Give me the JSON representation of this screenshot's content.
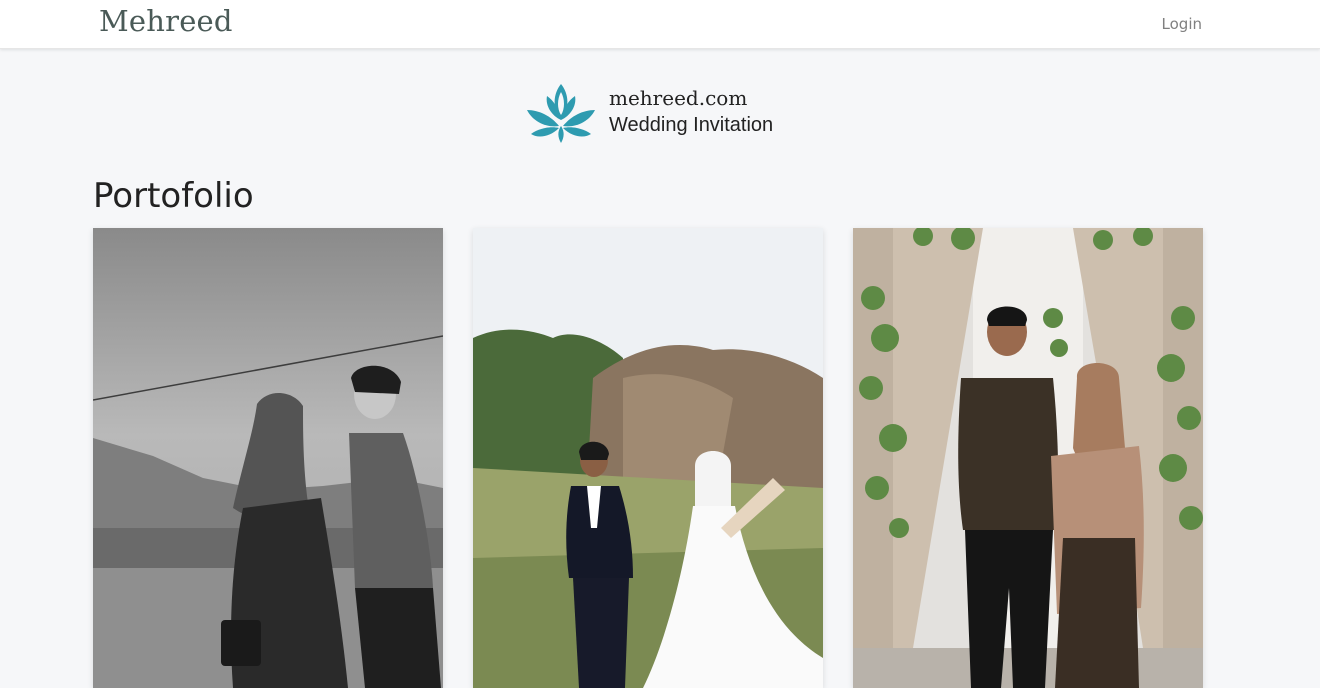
{
  "navbar": {
    "brand": "Mehreed",
    "login_label": "Login"
  },
  "header": {
    "site_name": "mehreed.com",
    "tagline": "Wedding Invitation",
    "logo_icon": "lotus-icon",
    "logo_color": "#2e9bb0"
  },
  "portfolio": {
    "title": "Portofolio"
  },
  "colors": {
    "brand_text": "#4a5a57",
    "background": "#f6f7f9",
    "navbar_bg": "#ffffff"
  }
}
